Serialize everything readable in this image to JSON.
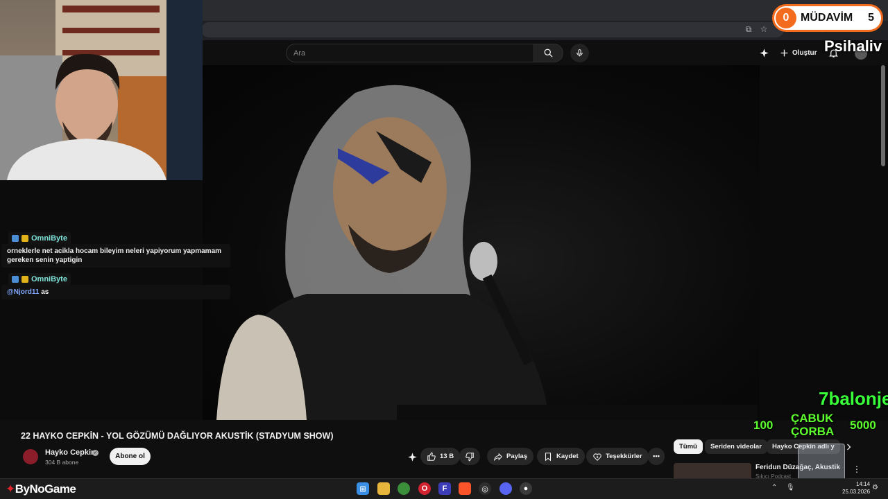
{
  "youtube": {
    "search_placeholder": "Ara",
    "create_label": "Oluştur"
  },
  "video": {
    "title": "22 HAYKO CEPKİN - YOL GÖZÜMÜ DAĞLIYOR AKUSTİK (STADYUM SHOW)",
    "channel": "Hayko Cepkin",
    "subscribers": "304 B abone",
    "subscribe_label": "Abone ol",
    "actions": {
      "likes": "13 B",
      "share": "Paylaş",
      "save": "Kaydet",
      "thanks": "Teşekkürler"
    }
  },
  "side": {
    "chips": [
      "Tümü",
      "Seriden videolar",
      "Hayko Cepkin adlı y"
    ],
    "rec_title": "Feridun Düzağaç, Akustik",
    "rec_sub": "Sıkıcı Podcast"
  },
  "chat": [
    {
      "user": "OmniByte",
      "text": "orneklerle net acikla hocam bileyim neleri yapiyorum yapmamam gereken senin yaptigin"
    },
    {
      "user": "OmniByte",
      "mention": "@Njord11",
      "text": " as"
    }
  ],
  "overlay": {
    "mudavim_left": "0",
    "mudavim_label": "MÜDAVİM",
    "mudavim_right": "5",
    "psihaliv": "Psihaliv",
    "balon": "7balonje",
    "left_num": "100",
    "middle_1": "ÇABUK",
    "middle_2": "ÇORBA",
    "right_num": "5000"
  },
  "taskbar": {
    "brand": "ByNoGame",
    "time": "14:14",
    "date": "25.03.2026"
  },
  "colors": {
    "accent": "#f36b1c",
    "youtube_bg": "#0f0f0f",
    "overlay_green": "#39ff3a"
  }
}
